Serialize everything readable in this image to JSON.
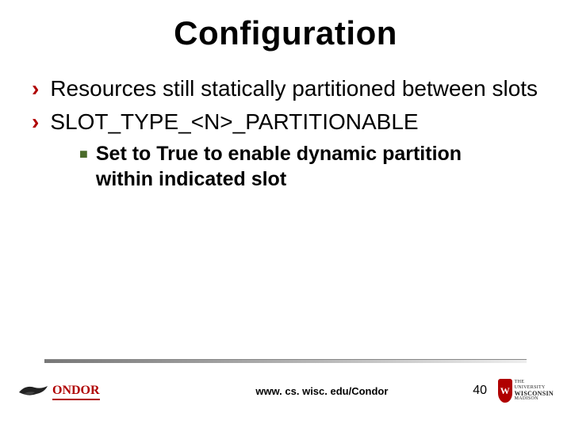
{
  "title": "Configuration",
  "bullets": [
    {
      "level": 1,
      "text": "Resources still statically partitioned between slots"
    },
    {
      "level": 1,
      "text": "SLOT_TYPE_<N>_PARTITIONABLE"
    },
    {
      "level": 2,
      "text": "Set to True to enable dynamic partition within indicated slot"
    }
  ],
  "footer": {
    "condor_label": "ONDOR",
    "url": "www. cs. wisc. edu/Condor",
    "page_number": "40",
    "uw_line1": "THE UNIVERSITY",
    "uw_wis": "WISCONSIN",
    "uw_line3": "MADISON"
  }
}
